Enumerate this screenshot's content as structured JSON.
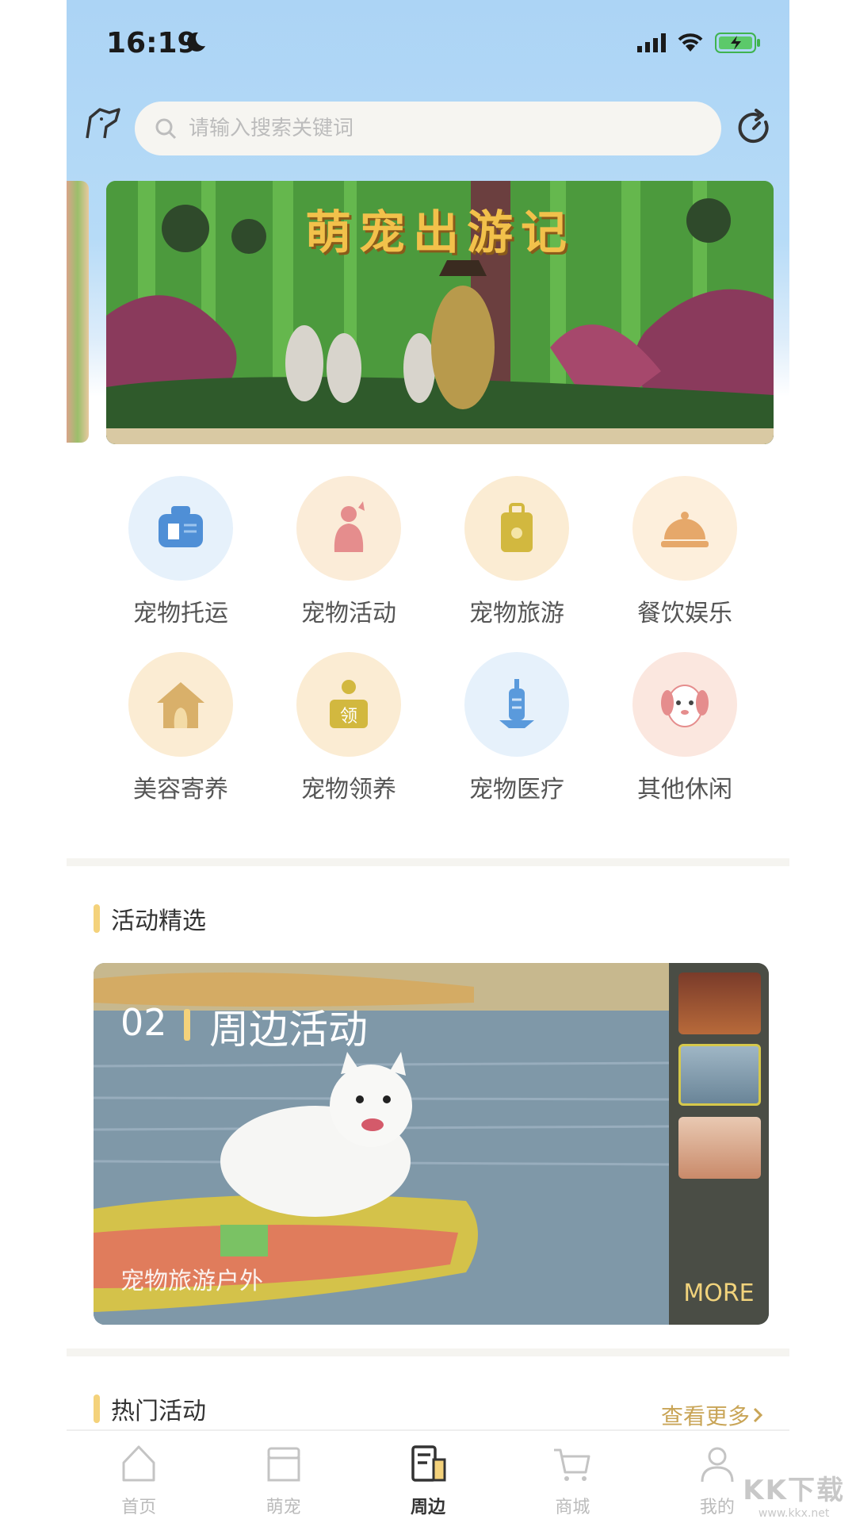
{
  "status_bar": {
    "time": "16:19"
  },
  "search": {
    "placeholder": "请输入搜索关键词"
  },
  "banner": {
    "title": "萌宠出游记"
  },
  "categories": [
    {
      "label": "宠物托运",
      "icon": "carrier-icon",
      "color": "#4f8fd6"
    },
    {
      "label": "宠物活动",
      "icon": "cat-icon",
      "color": "#e58d8d"
    },
    {
      "label": "宠物旅游",
      "icon": "suitcase-icon",
      "color": "#d2b83f"
    },
    {
      "label": "餐饮娱乐",
      "icon": "cloche-icon",
      "color": "#e6a86a"
    },
    {
      "label": "美容寄养",
      "icon": "house-icon",
      "color": "#d9b06a"
    },
    {
      "label": "宠物领养",
      "icon": "adopt-icon",
      "color": "#d2b83f",
      "badge": "领"
    },
    {
      "label": "宠物医疗",
      "icon": "syringe-icon",
      "color": "#5a9adc"
    },
    {
      "label": "其他休闲",
      "icon": "dog-face-icon",
      "color": "#e58d8d"
    }
  ],
  "featured": {
    "section_title": "活动精选",
    "number": "02",
    "title": "周边活动",
    "subtitle": "宠物旅游户外",
    "more_label": "MORE"
  },
  "hot": {
    "section_title": "热门活动",
    "more_label": "查看更多"
  },
  "tabbar": {
    "items": [
      {
        "label": "首页",
        "icon": "home-icon"
      },
      {
        "label": "萌宠",
        "icon": "shop-icon"
      },
      {
        "label": "周边",
        "icon": "nearby-icon",
        "active": true
      },
      {
        "label": "商城",
        "icon": "cart-icon"
      },
      {
        "label": "我的",
        "icon": "user-icon"
      }
    ]
  },
  "watermark": {
    "logo": "KK下载",
    "url": "www.kkx.net"
  },
  "colors": {
    "accent": "#f4d27b",
    "sky": "#acd4f5",
    "more_gold": "#c9a557"
  }
}
